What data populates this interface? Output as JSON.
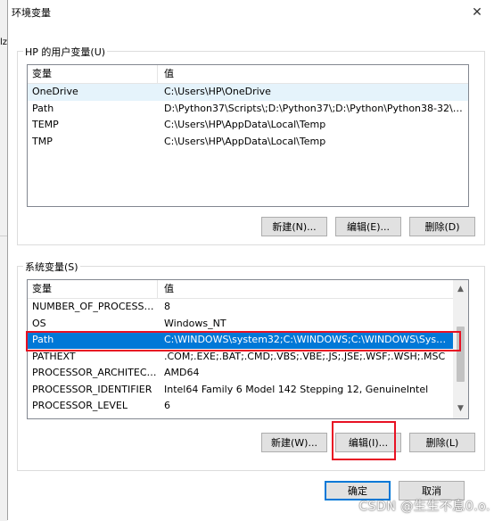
{
  "background": {
    "fragment": "lz"
  },
  "window": {
    "title": "环境变量",
    "close_glyph": "✕"
  },
  "user_vars": {
    "legend": "HP 的用户变量(U)",
    "columns": [
      "变量",
      "值"
    ],
    "rows": [
      {
        "name": "OneDrive",
        "value": "C:\\Users\\HP\\OneDrive"
      },
      {
        "name": "Path",
        "value": "D:\\Python37\\Scripts\\;D:\\Python37\\;D:\\Python\\Python38-32\\Scr..."
      },
      {
        "name": "TEMP",
        "value": "C:\\Users\\HP\\AppData\\Local\\Temp"
      },
      {
        "name": "TMP",
        "value": "C:\\Users\\HP\\AppData\\Local\\Temp"
      }
    ],
    "buttons": {
      "new": "新建(N)...",
      "edit": "编辑(E)...",
      "delete": "删除(D)"
    }
  },
  "system_vars": {
    "legend": "系统变量(S)",
    "columns": [
      "变量",
      "值"
    ],
    "rows": [
      {
        "name": "NUMBER_OF_PROCESSORS",
        "value": "8"
      },
      {
        "name": "OS",
        "value": "Windows_NT"
      },
      {
        "name": "Path",
        "value": "C:\\WINDOWS\\system32;C:\\WINDOWS;C:\\WINDOWS\\System..."
      },
      {
        "name": "PATHEXT",
        "value": ".COM;.EXE;.BAT;.CMD;.VBS;.VBE;.JS;.JSE;.WSF;.WSH;.MSC"
      },
      {
        "name": "PROCESSOR_ARCHITECT...",
        "value": "AMD64"
      },
      {
        "name": "PROCESSOR_IDENTIFIER",
        "value": "Intel64 Family 6 Model 142 Stepping 12, GenuineIntel"
      },
      {
        "name": "PROCESSOR_LEVEL",
        "value": "6"
      }
    ],
    "buttons": {
      "new": "新建(W)...",
      "edit": "编辑(I)...",
      "delete": "删除(L)"
    }
  },
  "footer": {
    "ok": "确定",
    "cancel": "取消"
  },
  "watermark": "CSDN @生生不息0.o.",
  "icons": {
    "scroll_up": "scroll-up-arrow-icon",
    "scroll_down": "scroll-down-arrow-icon",
    "close": "close-icon"
  },
  "colors": {
    "selection": "#0078d7",
    "hover_row": "#e5f3fb",
    "highlight_box": "#e81123"
  }
}
